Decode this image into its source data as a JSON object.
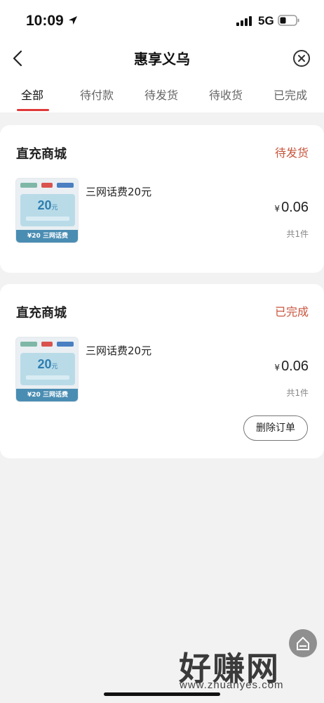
{
  "status_bar": {
    "time": "10:09",
    "network": "5G",
    "icons": [
      "location-arrow-icon",
      "signal-icon",
      "battery-icon"
    ]
  },
  "nav": {
    "title": "惠享义乌",
    "back_icon": "chevron-left-icon",
    "close_icon": "close-circle-icon"
  },
  "tabs": [
    {
      "label": "全部",
      "active": true
    },
    {
      "label": "待付款",
      "active": false
    },
    {
      "label": "待发货",
      "active": false
    },
    {
      "label": "待收货",
      "active": false
    },
    {
      "label": "已完成",
      "active": false
    }
  ],
  "orders": [
    {
      "shop": "直充商城",
      "status": "待发货",
      "product": {
        "name": "三网话费20元",
        "image_amount": "20",
        "image_unit": "元",
        "image_footer": "¥20 三网话费"
      },
      "price_symbol": "¥",
      "price": "0.06",
      "quantity": "共1件"
    },
    {
      "shop": "直充商城",
      "status": "已完成",
      "product": {
        "name": "三网话费20元",
        "image_amount": "20",
        "image_unit": "元",
        "image_footer": "¥20 三网话费"
      },
      "price_symbol": "¥",
      "price": "0.06",
      "quantity": "共1件",
      "action": "删除订单"
    }
  ],
  "watermark": {
    "text": "好赚网",
    "url": "www.zhuanyes.com"
  },
  "colors": {
    "accent": "#e0393b",
    "status": "#c8553d",
    "background": "#f2f2f3"
  }
}
